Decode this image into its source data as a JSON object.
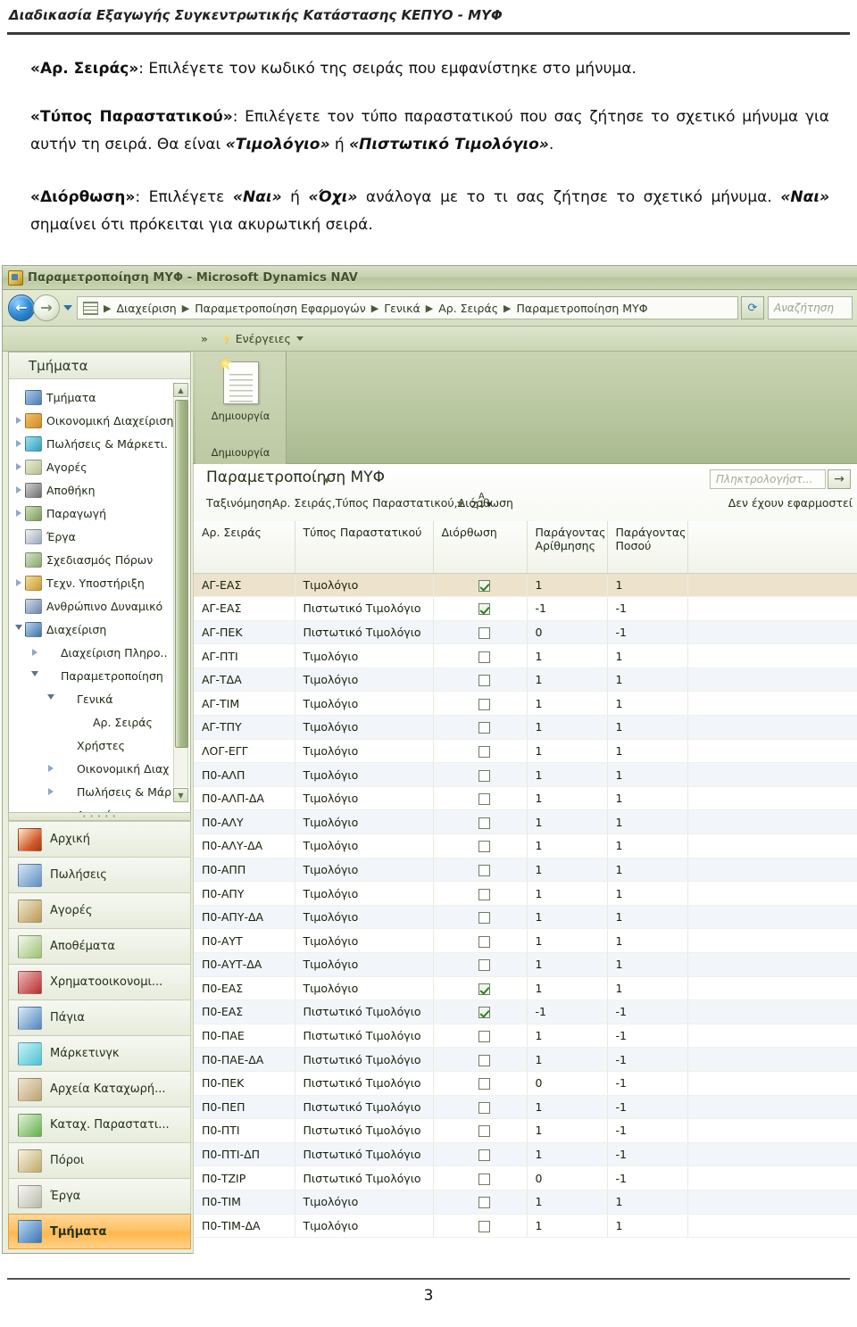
{
  "document": {
    "running_head": "Διαδικασία Εξαγωγής Συγκεντρωτικής Κατάστασης ΚΕΠΥΟ - ΜΥΦ",
    "page_number": "3",
    "paragraphs": {
      "p1": {
        "term": "«Αρ. Σειράς»",
        "rest": ": Επιλέγετε τον κωδικό της σειράς που εμφανίστηκε στο μήνυμα."
      },
      "p2": {
        "term": "«Τύπος Παραστατικού»",
        "rest1": ": Επιλέγετε τον τύπο παραστατικού που σας ζήτησε το σχετικό μήνυμα για αυτήν τη σειρά. Θα είναι ",
        "em1": "«Τιμολόγιο»",
        "mid": " ή ",
        "em2": "«Πιστωτικό Τιμολόγιο»",
        "rest2": "."
      },
      "p3": {
        "term": "«Διόρθωση»",
        "rest1": ": Επιλέγετε ",
        "em1": "«Ναι»",
        "mid1": " ή ",
        "em2": "«Όχι»",
        "rest2": " ανάλογα με το τι σας ζήτησε το σχετικό μήνυμα. ",
        "em3": "«Ναι»",
        "rest3": " σημαίνει ότι πρόκειται για ακυρωτική σειρά."
      }
    }
  },
  "window": {
    "title": "Παραμετροποίηση ΜΥΦ - Microsoft Dynamics NAV",
    "back_icon": "back-arrow-icon",
    "forward_icon": "forward-arrow-icon",
    "breadcrumb": [
      "Διαχείριση",
      "Παραμετροποίηση Εφαρμογών",
      "Γενικά",
      "Αρ. Σειράς",
      "Παραμετροποίηση ΜΥΦ"
    ],
    "refresh_icon": "refresh-icon",
    "search_placeholder": "Αναζήτηση",
    "ribbon": {
      "expand_icon": "chevron-double-right-icon",
      "actions_tab": "Ενέργειες",
      "bolt_icon": "lightning-bolt-icon",
      "new_button": "Δημιουργία",
      "new_group": "Δημιουργία",
      "new_icon": "new-document-icon"
    }
  },
  "sidebar": {
    "title": "Τμήματα",
    "tree": [
      {
        "label": "Τμήματα",
        "expander": "none",
        "indent": 0,
        "icon": "departments-icon",
        "icon_class": "ic-a"
      },
      {
        "label": "Οικονομική Διαχείριση",
        "expander": "collapsed",
        "indent": 0,
        "icon": "finance-icon",
        "icon_class": "ic-b"
      },
      {
        "label": "Πωλήσεις & Μάρκετι.",
        "expander": "collapsed",
        "indent": 0,
        "icon": "sales-icon",
        "icon_class": "ic-c"
      },
      {
        "label": "Αγορές",
        "expander": "collapsed",
        "indent": 0,
        "icon": "purchase-icon",
        "icon_class": "ic-d"
      },
      {
        "label": "Αποθήκη",
        "expander": "collapsed",
        "indent": 0,
        "icon": "warehouse-icon",
        "icon_class": "ic-e"
      },
      {
        "label": "Παραγωγή",
        "expander": "collapsed",
        "indent": 0,
        "icon": "manufacturing-icon",
        "icon_class": "ic-f"
      },
      {
        "label": "Έργα",
        "expander": "none",
        "indent": 0,
        "icon": "jobs-icon",
        "icon_class": "ic-g"
      },
      {
        "label": "Σχεδιασμός Πόρων",
        "expander": "none",
        "indent": 0,
        "icon": "resource-planning-icon",
        "icon_class": "ic-h"
      },
      {
        "label": "Τεχν. Υποστήριξη",
        "expander": "collapsed",
        "indent": 0,
        "icon": "service-icon",
        "icon_class": "ic-i"
      },
      {
        "label": "Ανθρώπινο Δυναμικό",
        "expander": "none",
        "indent": 0,
        "icon": "hr-icon",
        "icon_class": "ic-j"
      },
      {
        "label": "Διαχείριση",
        "expander": "expanded",
        "indent": 0,
        "icon": "administration-icon",
        "icon_class": "ic-k"
      },
      {
        "label": "Διαχείριση Πληρο..",
        "expander": "collapsed",
        "indent": 1,
        "icon": "",
        "icon_class": ""
      },
      {
        "label": "Παραμετροποίηση",
        "expander": "expanded",
        "indent": 1,
        "icon": "",
        "icon_class": ""
      },
      {
        "label": "Γενικά",
        "expander": "expanded",
        "indent": 2,
        "icon": "",
        "icon_class": ""
      },
      {
        "label": "Αρ. Σειράς",
        "expander": "none",
        "indent": 3,
        "icon": "",
        "icon_class": ""
      },
      {
        "label": "Χρήστες",
        "expander": "none",
        "indent": 2,
        "icon": "",
        "icon_class": ""
      },
      {
        "label": "Οικονομική Διαχ",
        "expander": "collapsed",
        "indent": 2,
        "icon": "",
        "icon_class": ""
      },
      {
        "label": "Πωλήσεις & Μάρ",
        "expander": "collapsed",
        "indent": 2,
        "icon": "",
        "icon_class": ""
      },
      {
        "label": "Αγορά",
        "expander": "none",
        "indent": 2,
        "icon": "",
        "icon_class": ""
      }
    ],
    "scroll_up_icon": "scroll-up-icon",
    "scroll_down_icon": "scroll-down-icon",
    "nav_buttons": [
      {
        "label": "Αρχική",
        "icon": "home-icon",
        "icon_class": "n1",
        "selected": false
      },
      {
        "label": "Πωλήσεις",
        "icon": "sales-icon",
        "icon_class": "n2",
        "selected": false
      },
      {
        "label": "Αγορές",
        "icon": "purchases-icon",
        "icon_class": "n3",
        "selected": false
      },
      {
        "label": "Αποθέματα",
        "icon": "inventory-icon",
        "icon_class": "n4",
        "selected": false
      },
      {
        "label": "Χρηματοοικονομι...",
        "icon": "financials-icon",
        "icon_class": "n5",
        "selected": false
      },
      {
        "label": "Πάγια",
        "icon": "fixed-assets-icon",
        "icon_class": "n6",
        "selected": false
      },
      {
        "label": "Μάρκετινγκ",
        "icon": "marketing-icon",
        "icon_class": "n7",
        "selected": false
      },
      {
        "label": "Αρχεία Καταχωρή...",
        "icon": "posted-files-icon",
        "icon_class": "n8",
        "selected": false
      },
      {
        "label": "Καταχ. Παραστατι...",
        "icon": "posted-documents-icon",
        "icon_class": "n9",
        "selected": false
      },
      {
        "label": "Πόροι",
        "icon": "resources-icon",
        "icon_class": "n10",
        "selected": false
      },
      {
        "label": "Έργα",
        "icon": "jobs-icon",
        "icon_class": "n11",
        "selected": false
      },
      {
        "label": "Τμήματα",
        "icon": "departments-icon",
        "icon_class": "n12",
        "selected": true
      }
    ]
  },
  "list": {
    "title": "Παραμετροποίηση ΜΥΦ",
    "sort_label": "Ταξινόμηση:",
    "sort_value": "Αρ. Σειράς,Τύπος Παραστατικού,Διόρθωση",
    "sort_icon": "sort-az-icon",
    "filter_status": "Δεν έχουν εφαρμοστεί",
    "quick_search_placeholder": "Πληκτρολογήστ...",
    "quick_search_go": "→",
    "columns": [
      "Αρ. Σειράς",
      "Τύπος Παραστατικού",
      "Διόρθωση",
      "Παράγοντας Αρίθμησης",
      "Παράγοντας Ποσού",
      ""
    ],
    "rows": [
      {
        "series": "ΑΓ-ΕΑΣ",
        "doctype": "Τιμολόγιο",
        "correction": true,
        "num_factor": "1",
        "amt_factor": "1"
      },
      {
        "series": "ΑΓ-ΕΑΣ",
        "doctype": "Πιστωτικό Τιμολόγιο",
        "correction": true,
        "num_factor": "-1",
        "amt_factor": "-1"
      },
      {
        "series": "ΑΓ-ΠΕΚ",
        "doctype": "Πιστωτικό Τιμολόγιο",
        "correction": false,
        "num_factor": "0",
        "amt_factor": "-1"
      },
      {
        "series": "ΑΓ-ΠΤΙ",
        "doctype": "Τιμολόγιο",
        "correction": false,
        "num_factor": "1",
        "amt_factor": "1"
      },
      {
        "series": "ΑΓ-ΤΔΑ",
        "doctype": "Τιμολόγιο",
        "correction": false,
        "num_factor": "1",
        "amt_factor": "1"
      },
      {
        "series": "ΑΓ-ΤΙΜ",
        "doctype": "Τιμολόγιο",
        "correction": false,
        "num_factor": "1",
        "amt_factor": "1"
      },
      {
        "series": "ΑΓ-ΤΠΥ",
        "doctype": "Τιμολόγιο",
        "correction": false,
        "num_factor": "1",
        "amt_factor": "1"
      },
      {
        "series": "ΛΟΓ-ΕΓΓ",
        "doctype": "Τιμολόγιο",
        "correction": false,
        "num_factor": "1",
        "amt_factor": "1"
      },
      {
        "series": "Π0-ΑΛΠ",
        "doctype": "Τιμολόγιο",
        "correction": false,
        "num_factor": "1",
        "amt_factor": "1"
      },
      {
        "series": "Π0-ΑΛΠ-ΔΑ",
        "doctype": "Τιμολόγιο",
        "correction": false,
        "num_factor": "1",
        "amt_factor": "1"
      },
      {
        "series": "Π0-ΑΛΥ",
        "doctype": "Τιμολόγιο",
        "correction": false,
        "num_factor": "1",
        "amt_factor": "1"
      },
      {
        "series": "Π0-ΑΛΥ-ΔΑ",
        "doctype": "Τιμολόγιο",
        "correction": false,
        "num_factor": "1",
        "amt_factor": "1"
      },
      {
        "series": "Π0-ΑΠΠ",
        "doctype": "Τιμολόγιο",
        "correction": false,
        "num_factor": "1",
        "amt_factor": "1"
      },
      {
        "series": "Π0-ΑΠΥ",
        "doctype": "Τιμολόγιο",
        "correction": false,
        "num_factor": "1",
        "amt_factor": "1"
      },
      {
        "series": "Π0-ΑΠΥ-ΔΑ",
        "doctype": "Τιμολόγιο",
        "correction": false,
        "num_factor": "1",
        "amt_factor": "1"
      },
      {
        "series": "Π0-ΑΥΤ",
        "doctype": "Τιμολόγιο",
        "correction": false,
        "num_factor": "1",
        "amt_factor": "1"
      },
      {
        "series": "Π0-ΑΥΤ-ΔΑ",
        "doctype": "Τιμολόγιο",
        "correction": false,
        "num_factor": "1",
        "amt_factor": "1"
      },
      {
        "series": "Π0-ΕΑΣ",
        "doctype": "Τιμολόγιο",
        "correction": true,
        "num_factor": "1",
        "amt_factor": "1"
      },
      {
        "series": "Π0-ΕΑΣ",
        "doctype": "Πιστωτικό Τιμολόγιο",
        "correction": true,
        "num_factor": "-1",
        "amt_factor": "-1"
      },
      {
        "series": "Π0-ΠΑΕ",
        "doctype": "Πιστωτικό Τιμολόγιο",
        "correction": false,
        "num_factor": "1",
        "amt_factor": "-1"
      },
      {
        "series": "Π0-ΠΑΕ-ΔΑ",
        "doctype": "Πιστωτικό Τιμολόγιο",
        "correction": false,
        "num_factor": "1",
        "amt_factor": "-1"
      },
      {
        "series": "Π0-ΠΕΚ",
        "doctype": "Πιστωτικό Τιμολόγιο",
        "correction": false,
        "num_factor": "0",
        "amt_factor": "-1"
      },
      {
        "series": "Π0-ΠΕΠ",
        "doctype": "Πιστωτικό Τιμολόγιο",
        "correction": false,
        "num_factor": "1",
        "amt_factor": "-1"
      },
      {
        "series": "Π0-ΠΤΙ",
        "doctype": "Πιστωτικό Τιμολόγιο",
        "correction": false,
        "num_factor": "1",
        "amt_factor": "-1"
      },
      {
        "series": "Π0-ΠΤΙ-ΔΠ",
        "doctype": "Πιστωτικό Τιμολόγιο",
        "correction": false,
        "num_factor": "1",
        "amt_factor": "-1"
      },
      {
        "series": "Π0-ΤΖΙΡ",
        "doctype": "Πιστωτικό Τιμολόγιο",
        "correction": false,
        "num_factor": "0",
        "amt_factor": "-1"
      },
      {
        "series": "Π0-ΤΙΜ",
        "doctype": "Τιμολόγιο",
        "correction": false,
        "num_factor": "1",
        "amt_factor": "1"
      },
      {
        "series": "Π0-ΤΙΜ-ΔΑ",
        "doctype": "Τιμολόγιο",
        "correction": false,
        "num_factor": "1",
        "amt_factor": "1"
      }
    ]
  },
  "colors": {
    "nav_chrome": "#c5d1ae",
    "selected_row": "#ede2cc",
    "alt_row": "#f2f6fb",
    "nav_selected_button": "#ffc061",
    "check_green": "#2f7d26"
  }
}
